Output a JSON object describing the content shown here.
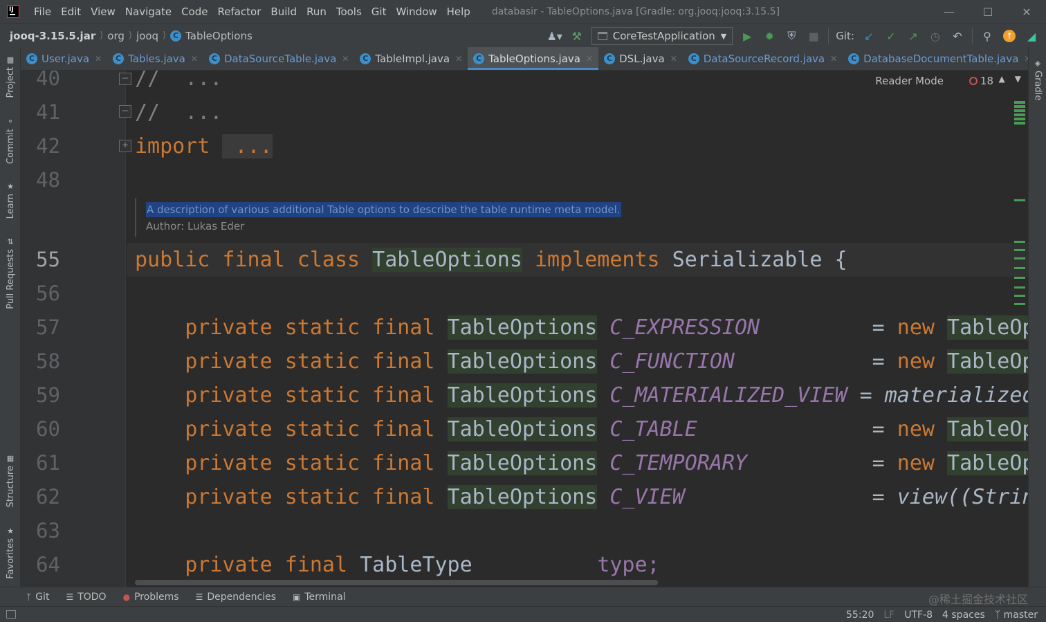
{
  "menubar": {
    "items": [
      "File",
      "Edit",
      "View",
      "Navigate",
      "Code",
      "Refactor",
      "Build",
      "Run",
      "Tools",
      "Git",
      "Window",
      "Help"
    ],
    "window_title": "databasir - TableOptions.java [Gradle: org.jooq:jooq:3.15.5]"
  },
  "navbar": {
    "breadcrumbs": [
      "jooq-3.15.5.jar",
      "org",
      "jooq",
      "TableOptions"
    ],
    "run_config": "CoreTestApplication",
    "git_label": "Git:"
  },
  "left_tools": [
    "Project",
    "Commit",
    "Learn",
    "Pull Requests",
    "Structure",
    "Favorites"
  ],
  "right_tools": [
    "Gradle"
  ],
  "tabs": [
    {
      "label": "User.java",
      "active": false
    },
    {
      "label": "Tables.java",
      "active": false
    },
    {
      "label": "DataSourceTable.java",
      "active": false
    },
    {
      "label": "TableImpl.java",
      "active": false
    },
    {
      "label": "TableOptions.java",
      "active": true
    },
    {
      "label": "DSL.java",
      "active": false
    },
    {
      "label": "DataSourceRecord.java",
      "active": false
    },
    {
      "label": "DatabaseDocumentTable.java",
      "active": false
    }
  ],
  "editor": {
    "reader_mode": "Reader Mode",
    "problem_count": "18",
    "line_numbers": [
      "40",
      "41",
      "42",
      "48",
      "55",
      "56",
      "57",
      "58",
      "59",
      "60",
      "61",
      "62",
      "63",
      "64"
    ],
    "doc": {
      "description": "A description of various additional Table options to describe the table runtime meta model.",
      "author": "Author: Lukas Eder"
    },
    "code": {
      "l40": "//  ...",
      "l41": "//  ...",
      "l42_kw": "import",
      "l42_dots": " ...",
      "l55_kw1": "public final class",
      "l55_cls": "TableOptions",
      "l55_kw2": "implements",
      "l55_rest": "Serializable {",
      "mod": "private static final",
      "type": "TableOptions",
      "eq": "=",
      "new": "new",
      "c1": "C_EXPRESSION",
      "c2": "C_FUNCTION",
      "c3": "C_MATERIALIZED_VIEW",
      "c4": "C_TABLE",
      "c5": "C_TEMPORARY",
      "c6": "C_VIEW",
      "r1": "TableOpt",
      "r2": "TableOpt",
      "r3": "materialized",
      "r4": "TableOpt",
      "r5": "TableOpt",
      "r6": "view((String",
      "l64_kw": "private final",
      "l64_type": "TableType",
      "l64_field": "type;"
    }
  },
  "bottom_tools": [
    "Git",
    "TODO",
    "Problems",
    "Dependencies",
    "Terminal"
  ],
  "watermark": "@稀土掘金技术社区",
  "status": {
    "position": "55:20",
    "line_sep": "LF",
    "encoding": "UTF-8",
    "indent": "4 spaces",
    "branch": "master"
  },
  "colors": {
    "keyword": "#cc7832",
    "constant": "#9876aa",
    "tab_accent": "#4a88c7",
    "class_highlight": "#32402f"
  }
}
